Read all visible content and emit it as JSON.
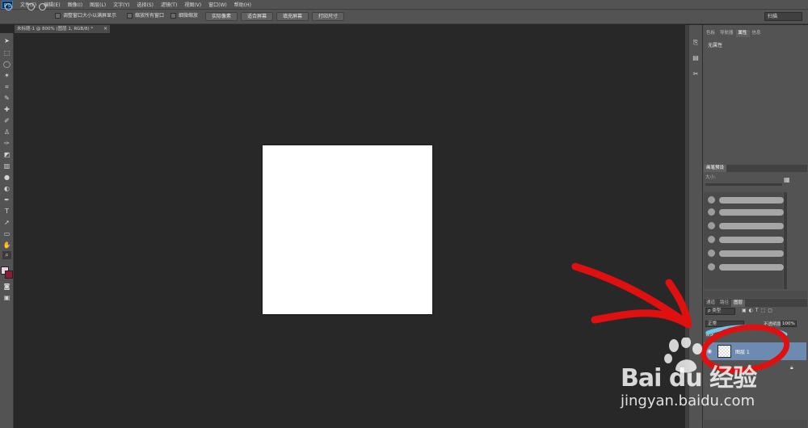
{
  "app": {
    "logo_text": "Ps"
  },
  "menubar": {
    "items": [
      "文件(F)",
      "编辑(E)",
      "图像(I)",
      "图层(L)",
      "文字(Y)",
      "选择(S)",
      "滤镜(T)",
      "视图(V)",
      "窗口(W)",
      "帮助(H)"
    ]
  },
  "options": {
    "resize_windows_label": "调整窗口大小以满屏显示",
    "zoom_all_label": "缩放所有窗口",
    "scrubby_zoom_label": "细微缩放",
    "actual_pixels_button": "实际像素",
    "fit_screen_button": "适合屏幕",
    "fill_screen_button": "填充屏幕",
    "print_size_button": "打印尺寸",
    "workspace": "扫描"
  },
  "document": {
    "tab_title": "未标题-1 @ 800% (图层 1, RGB/8) *",
    "close_glyph": "×"
  },
  "panels": {
    "top_tabs": [
      "色板",
      "导航器",
      "属性",
      "信息"
    ],
    "active_top_tab": "属性",
    "properties_text": "无属性",
    "brush_tab": "画笔预设",
    "brush_size_label": "大小:",
    "layers_tabs": [
      "通道",
      "路径",
      "图层"
    ],
    "active_layers_tab": "图层",
    "layer_filter": "ρ 类型",
    "blend_mode": "正常",
    "opacity_label": "不透明度:",
    "opacity_value": "100%",
    "lock_label": "锁定:",
    "fill_value": "%",
    "layer_name": "图层 1"
  },
  "watermark": {
    "brand_text": "Bai  du 经验",
    "url": "jingyan.baidu.com"
  },
  "colors": {
    "ui_gray": "#535353",
    "canvas_bg": "#282828",
    "selected_layer": "#6d8bb0",
    "annotation_red": "#e01010",
    "foreground_swatch": "#e9d3e4",
    "background_swatch": "#8a1c3a"
  }
}
